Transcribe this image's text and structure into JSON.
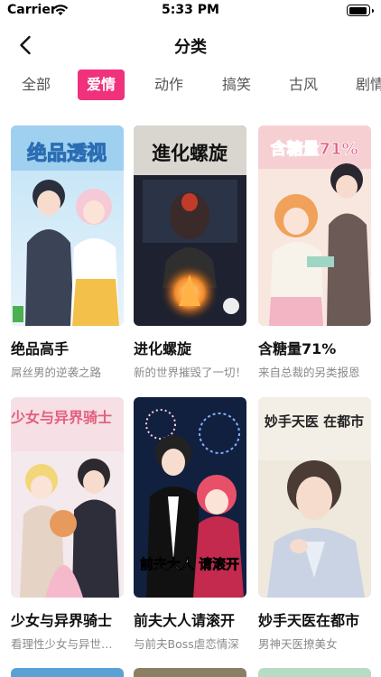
{
  "status_bar": {
    "carrier": "Carrier",
    "time": "5:33 PM"
  },
  "nav": {
    "title": "分类"
  },
  "tabs": [
    {
      "label": "全部",
      "active": false
    },
    {
      "label": "爱情",
      "active": true
    },
    {
      "label": "动作",
      "active": false
    },
    {
      "label": "搞笑",
      "active": false
    },
    {
      "label": "古风",
      "active": false
    },
    {
      "label": "剧情",
      "active": false
    }
  ],
  "comics": [
    {
      "title": "绝品高手",
      "subtitle": "屌丝男的逆袭之路",
      "cover_text": "绝品透视"
    },
    {
      "title": "进化螺旋",
      "subtitle": "新的世界摧毁了一切！",
      "cover_text": "進化螺旋"
    },
    {
      "title": "含糖量71%",
      "subtitle": "来自总裁的另类报恩",
      "cover_text": "含糖量71%"
    },
    {
      "title": "少女与异界骑士",
      "subtitle": "看理性少女与异世界骑士",
      "cover_text": "少女与异界骑士"
    },
    {
      "title": "前夫大人请滚开",
      "subtitle": "与前夫Boss虐恋情深",
      "cover_text": "前夫大人 请滚开"
    },
    {
      "title": "妙手天医在都市",
      "subtitle": "男神天医撩美女",
      "cover_text": "妙手天医 在都市"
    }
  ],
  "colors": {
    "accent": "#f0317b"
  }
}
